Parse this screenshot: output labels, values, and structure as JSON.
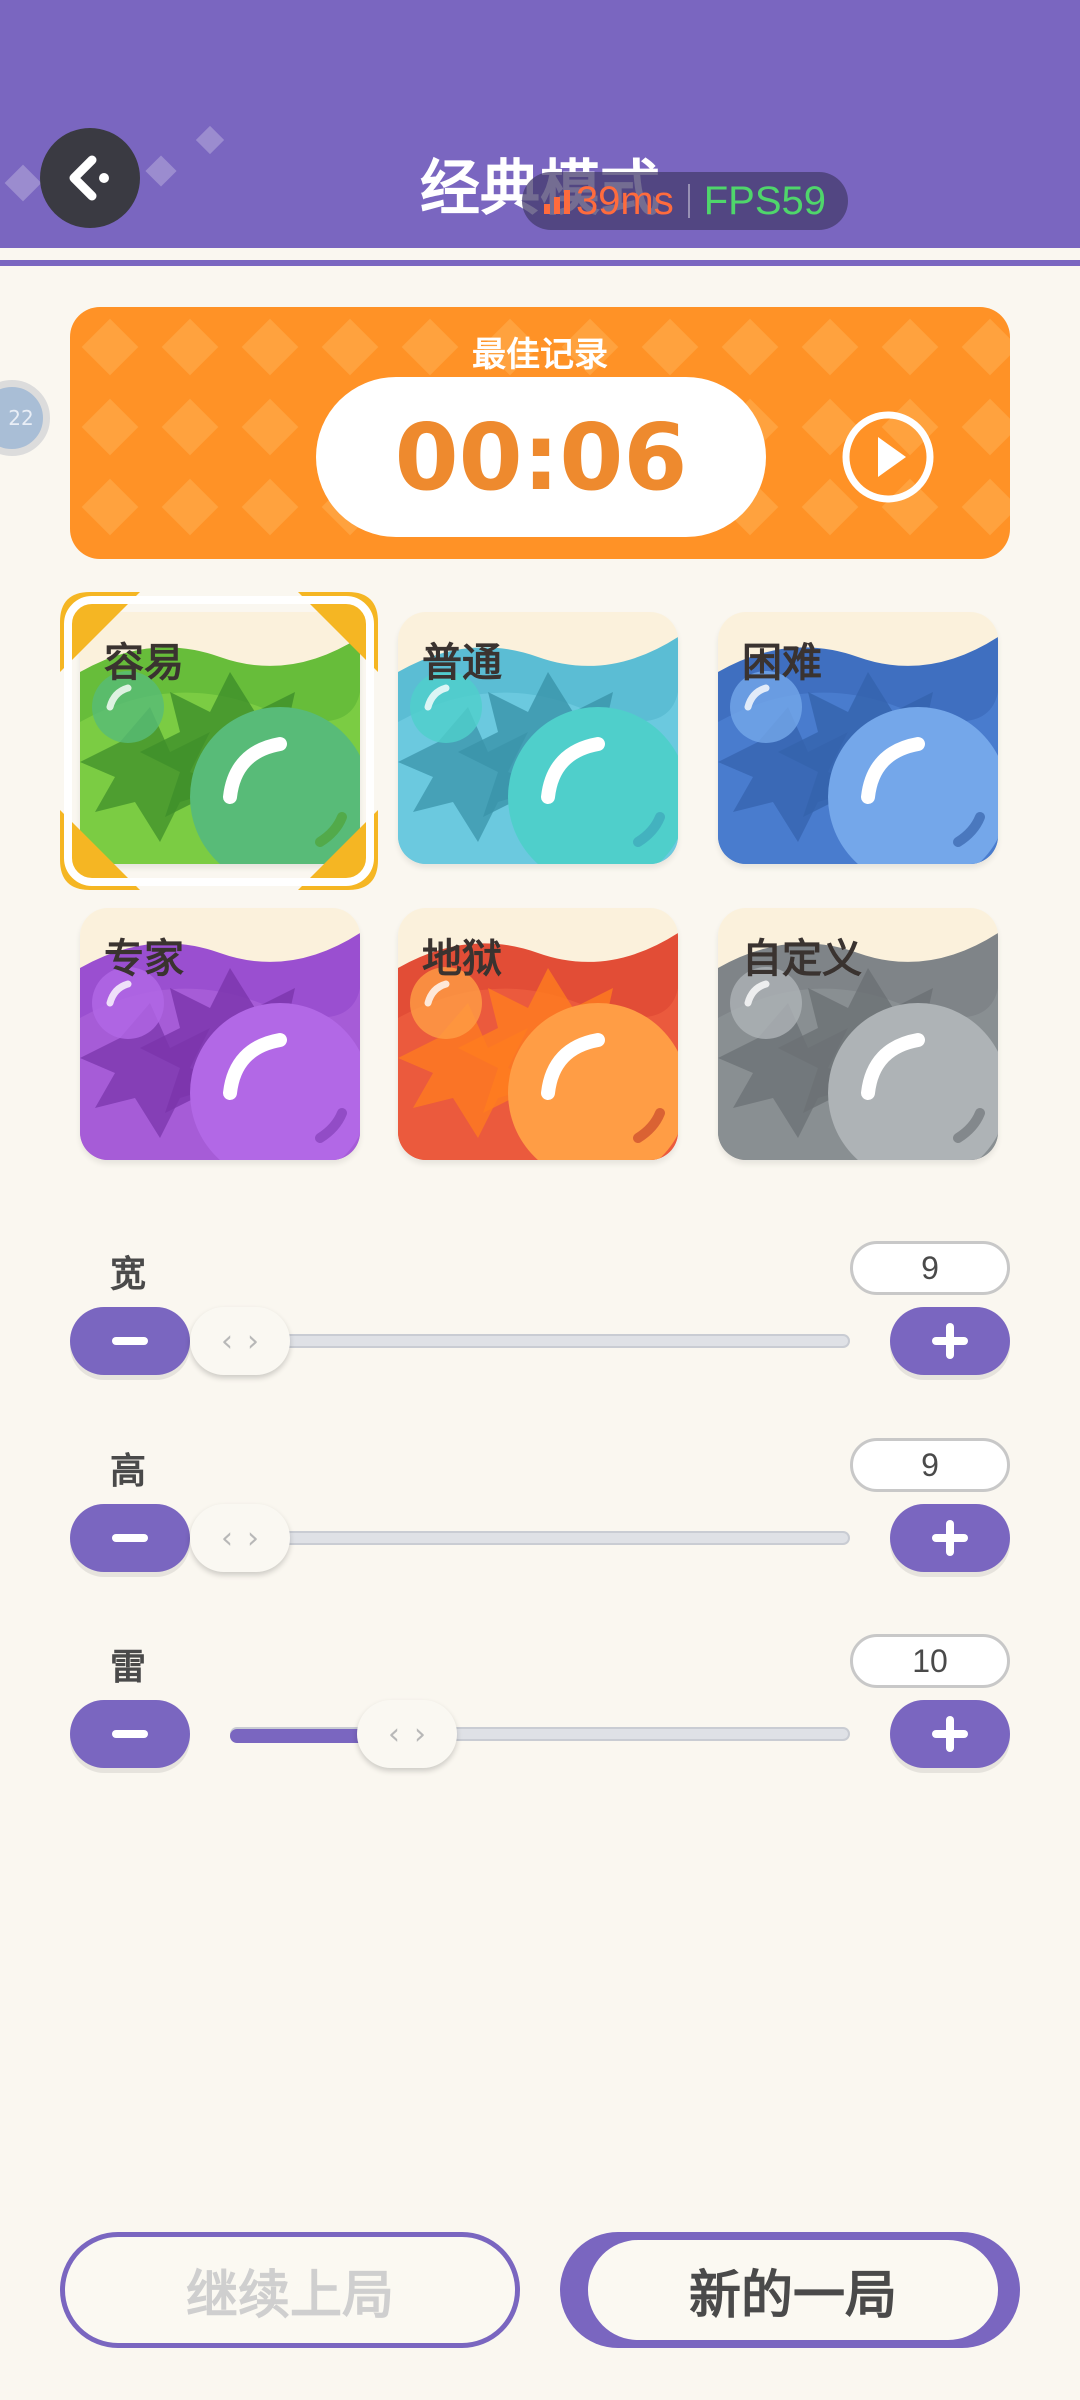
{
  "header": {
    "title": "经典模式",
    "ping": "39ms",
    "fps": "FPS59",
    "colors": {
      "bar": "#7a66c0",
      "ping": "#ff6b3d",
      "fps": "#4fd66b"
    }
  },
  "side_badge": {
    "text": "22"
  },
  "best_record": {
    "label": "最佳记录",
    "time": "00:06",
    "color": "#ff9226"
  },
  "difficulties": [
    {
      "label": "容易",
      "color": "green",
      "selected": true
    },
    {
      "label": "普通",
      "color": "teal",
      "selected": false
    },
    {
      "label": "困难",
      "color": "blue",
      "selected": false
    },
    {
      "label": "专家",
      "color": "purple",
      "selected": false
    },
    {
      "label": "地狱",
      "color": "red-orange",
      "selected": false
    },
    {
      "label": "自定义",
      "color": "gray",
      "selected": false
    }
  ],
  "settings": [
    {
      "label": "宽",
      "value": "9",
      "level": 0
    },
    {
      "label": "高",
      "value": "9",
      "level": 0
    },
    {
      "label": "雷",
      "value": "10",
      "level": 0.27
    }
  ],
  "actions": {
    "continue_label": "继续上局",
    "new_label": "新的一局"
  }
}
